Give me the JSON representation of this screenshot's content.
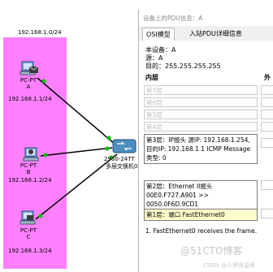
{
  "topology": {
    "network_label": "192.168.1.0/24",
    "pcs": [
      {
        "name": "PC-PT",
        "sub": "A",
        "ip": "192.168.1.1/24"
      },
      {
        "name": "PC-PT",
        "sub": "B",
        "ip": "192.168.1.2/24"
      },
      {
        "name": "PC-PT",
        "sub": "C",
        "ip": "192.168.1.3/24"
      }
    ],
    "switch": {
      "model": "2960-24TT",
      "label": "多层交换机0"
    },
    "colors": {
      "lan_area": "#ff80ff",
      "link_up": "#00c000",
      "link": "#000000"
    }
  },
  "dialog": {
    "title": "设备上的PDU信息：A",
    "tabs": [
      {
        "label": "OSI模型",
        "active": true
      },
      {
        "label": "入站PDU详细信息",
        "active": false
      }
    ],
    "device_line": "本设备：A",
    "source_line": "源：A",
    "dest_line": "目的：255.255.255.255",
    "col_in": "内层",
    "col_out": "外",
    "layers": [
      {
        "text": "第7层",
        "active": false
      },
      {
        "text": "第6层",
        "active": false
      },
      {
        "text": "第5层",
        "active": false
      },
      {
        "text": "第4层",
        "active": false
      },
      {
        "text": "第3层：IP报头 源IP: 192.168.1.254, 目的IP: 192.168.1.1 ICMP Message 类型: 0",
        "active": true
      },
      {
        "text": "第2层：Ethernet II报头 00E0.F727.A901 >> 0050.0F6D.9CD1",
        "active": true
      },
      {
        "text": "第1层：端口 FastEthernet0",
        "active": true,
        "highlight": true
      }
    ],
    "description": "1. FastEthernet0 receives the frame."
  },
  "watermark": {
    "main": "@51CTO博客",
    "sub": "CSDN @小罗很温柔"
  }
}
